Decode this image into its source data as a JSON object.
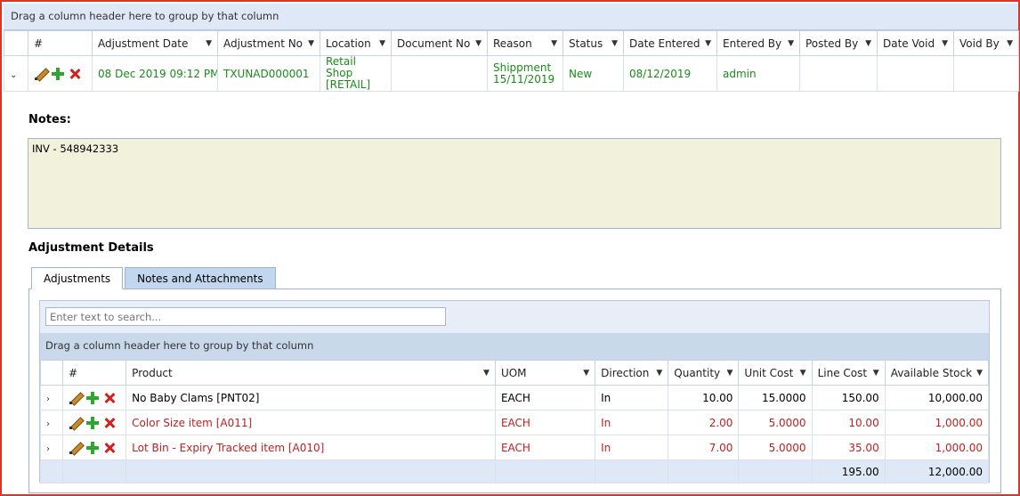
{
  "main": {
    "group_hint": "Drag a column header here to group by that column",
    "columns": [
      "#",
      "Adjustment Date",
      "Adjustment No",
      "Location",
      "Document No",
      "Reason",
      "Status",
      "Date Entered",
      "Entered By",
      "Posted By",
      "Date Void",
      "Void By"
    ],
    "row": {
      "adjustment_date": "08 Dec 2019 09:12 PM",
      "adjustment_no": "TXUNAD000001",
      "location_line1": "Retail Shop",
      "location_line2": "[RETAIL]",
      "document_no": "",
      "reason_line1": "Shippment",
      "reason_line2": "15/11/2019",
      "status": "New",
      "date_entered": "08/12/2019",
      "entered_by": "admin",
      "posted_by": "",
      "date_void": "",
      "void_by": ""
    }
  },
  "notes": {
    "title": "Notes:",
    "text": "INV - 548942333"
  },
  "details": {
    "title": "Adjustment Details",
    "tabs": [
      "Adjustments",
      "Notes and Attachments"
    ],
    "search_placeholder": "Enter text to search...",
    "group_hint": "Drag a column header here to group by that column",
    "columns": [
      "#",
      "Product",
      "UOM",
      "Direction",
      "Quantity",
      "Unit Cost",
      "Line Cost",
      "Available Stock"
    ],
    "rows": [
      {
        "product": "No Baby Clams [PNT02]",
        "uom": "EACH",
        "direction": "In",
        "quantity": "10.00",
        "unit_cost": "15.0000",
        "line_cost": "150.00",
        "available_stock": "10,000.00"
      },
      {
        "product": "Color Size item [A011]",
        "uom": "EACH",
        "direction": "In",
        "quantity": "2.00",
        "unit_cost": "5.0000",
        "line_cost": "10.00",
        "available_stock": "1,000.00"
      },
      {
        "product": "Lot Bin - Expiry Tracked item [A010]",
        "uom": "EACH",
        "direction": "In",
        "quantity": "7.00",
        "unit_cost": "5.0000",
        "line_cost": "35.00",
        "available_stock": "1,000.00"
      }
    ],
    "totals": {
      "line_cost": "195.00",
      "available_stock": "12,000.00"
    }
  },
  "colors": {
    "accent_border": "#d9362b",
    "header_bg": "#dfe8f6",
    "green_text": "#1a8a1a",
    "red_text": "#c02020",
    "notes_bg": "#f2f2dc"
  },
  "icons": [
    "chevron-down-icon",
    "edit-pencil-icon",
    "add-plus-icon",
    "delete-x-icon",
    "chevron-right-icon",
    "filter-icon"
  ]
}
